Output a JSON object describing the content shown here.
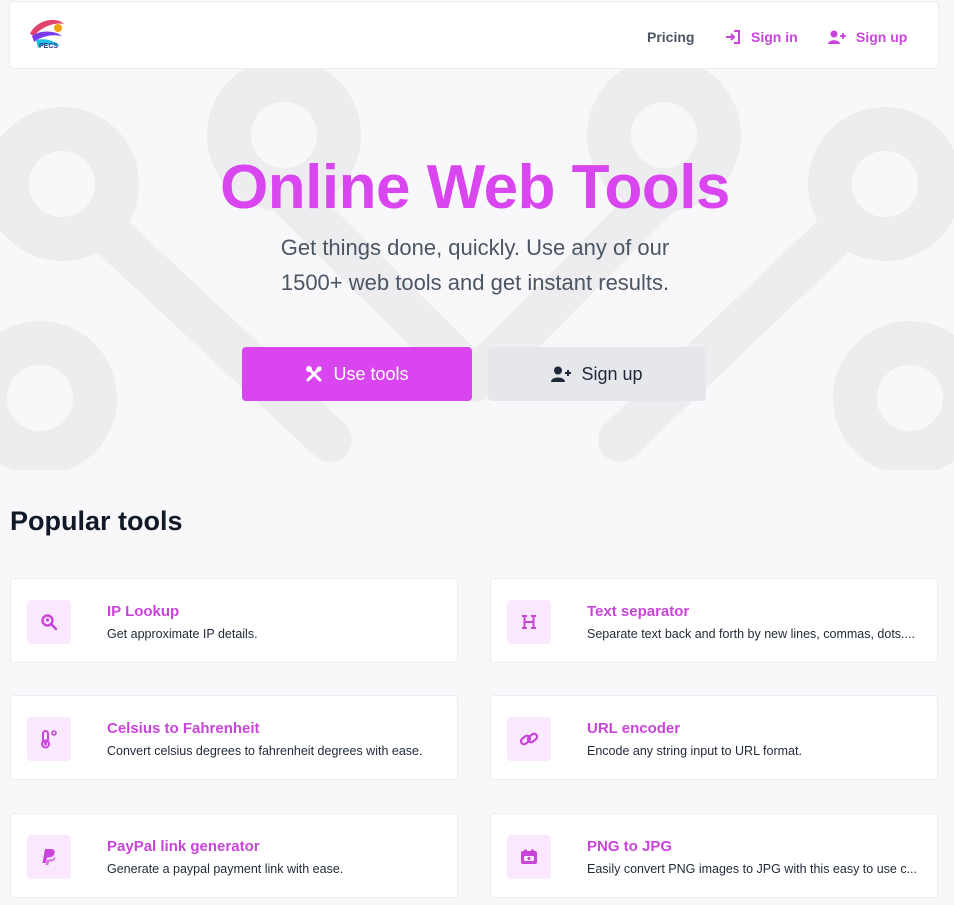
{
  "nav": {
    "pricing": "Pricing",
    "sign_in": "Sign in",
    "sign_up": "Sign up"
  },
  "hero": {
    "title": "Online Web Tools",
    "subtitle_line1": "Get things done, quickly. Use any of our",
    "subtitle_line2": "1500+ web tools and get instant results.",
    "use_tools": "Use tools",
    "sign_up": "Sign up"
  },
  "popular": {
    "title": "Popular tools",
    "tools": [
      {
        "name": "IP Lookup",
        "desc": "Get approximate IP details.",
        "icon": "search-location-icon"
      },
      {
        "name": "Text separator",
        "desc": "Separate text back and forth by new lines, commas, dots....",
        "icon": "heading-icon"
      },
      {
        "name": "Celsius to Fahrenheit",
        "desc": "Convert celsius degrees to fahrenheit degrees with ease.",
        "icon": "thermometer-icon"
      },
      {
        "name": "URL encoder",
        "desc": "Encode any string input to URL format.",
        "icon": "link-icon"
      },
      {
        "name": "PayPal link generator",
        "desc": "Generate a paypal payment link with ease.",
        "icon": "paypal-icon"
      },
      {
        "name": "PNG to JPG",
        "desc": "Easily convert PNG images to JPG with this easy to use c...",
        "icon": "image-icon"
      }
    ]
  },
  "colors": {
    "accent": "#d946ef",
    "accent_text": "#c944d9",
    "icon_bg": "#fae8ff",
    "secondary_button": "#e5e7eb",
    "page_bg": "#f8f8fb"
  }
}
